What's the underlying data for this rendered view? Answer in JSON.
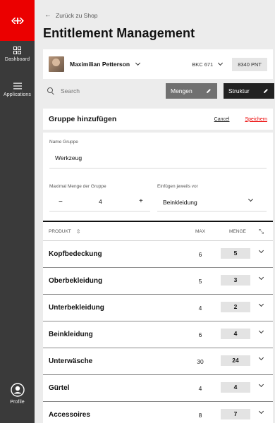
{
  "sidebar": {
    "logo_icon": "sbb-logo-icon",
    "brand_color": "#eb0000",
    "items": [
      {
        "label": "Dashboard",
        "icon": "dashboard-grid-icon"
      },
      {
        "label": "Applications",
        "icon": "hamburger-menu-icon"
      }
    ],
    "profile": {
      "label": "Profile",
      "icon": "user-circle-icon"
    }
  },
  "header": {
    "back_label": "Zurück zu Shop",
    "title": "Entitlement Management"
  },
  "user": {
    "name": "Maximilian Petterson",
    "cost_center": "BKC 671",
    "points": "8340 PNT"
  },
  "search": {
    "placeholder": "Search"
  },
  "toolbar": {
    "mengen_label": "Mengen",
    "struktur_label": "Struktur"
  },
  "group_form": {
    "title": "Gruppe hinzufügen",
    "cancel_label": "Cancel",
    "save_label": "Speichern",
    "name_label": "Name Gruppe",
    "name_value": "Werkzeug",
    "max_label": "Maximal Menge der Gruppe",
    "max_value": "4",
    "minus": "−",
    "plus": "+",
    "insert_label": "Einfügen jeweils vor",
    "insert_value": "Beinkleidung"
  },
  "table": {
    "col_product": "PRODUKT",
    "col_max": "MAX",
    "col_menge": "MENGE",
    "rows": [
      {
        "name": "Kopfbedeckung",
        "max": "6",
        "menge": "5"
      },
      {
        "name": "Oberbekleidung",
        "max": "5",
        "menge": "3"
      },
      {
        "name": "Unterbekleidung",
        "max": "4",
        "menge": "2"
      },
      {
        "name": "Beinkleidung",
        "max": "6",
        "menge": "4"
      },
      {
        "name": "Unterwäsche",
        "max": "30",
        "menge": "24"
      },
      {
        "name": "Gürtel",
        "max": "4",
        "menge": "4"
      },
      {
        "name": "Accessoires",
        "max": "8",
        "menge": "7"
      }
    ]
  }
}
